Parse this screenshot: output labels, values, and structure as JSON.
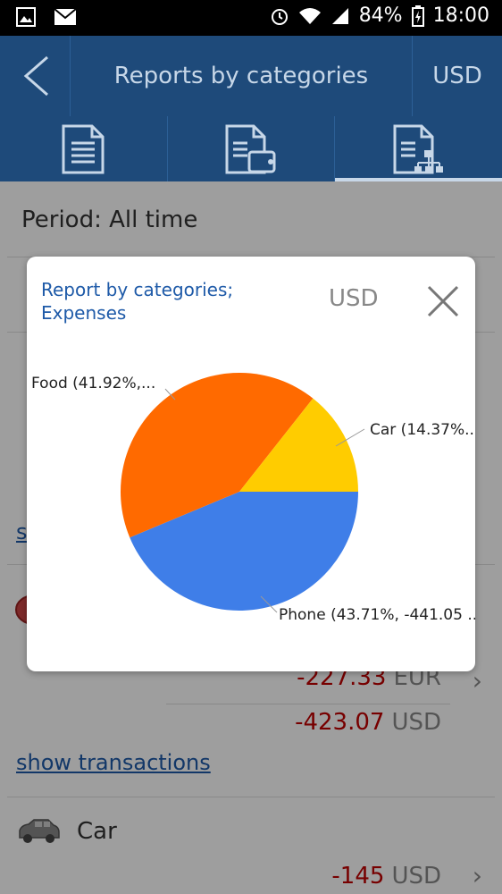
{
  "status_bar": {
    "battery_text": "84%",
    "time": "18:00",
    "icons": [
      "image-icon",
      "mail-icon",
      "alarm-icon",
      "wifi-icon",
      "signal-icon",
      "battery-icon"
    ]
  },
  "app_bar": {
    "title": "Reports by categories",
    "currency": "USD",
    "tabs": [
      {
        "name": "document-report-icon"
      },
      {
        "name": "wallet-report-icon"
      },
      {
        "name": "category-tree-report-icon"
      }
    ]
  },
  "background": {
    "period_label": "Period: All time",
    "link_partial": "s",
    "group": {
      "amount_eur": "-227.33",
      "amount_eur_currency": "EUR",
      "amount_usd": "-423.07",
      "amount_usd_currency": "USD",
      "show_transactions": "show transactions"
    },
    "car": {
      "name": "Car",
      "amount": "-145",
      "currency": "USD"
    }
  },
  "dialog": {
    "title_line1": "Report by categories;",
    "title_line2": "Expenses",
    "currency": "USD",
    "chart_labels": {
      "food": "Food (41.92%,...",
      "car": "Car (14.37%...",
      "phone": "Phone (43.71%, -441.05 ..."
    }
  },
  "chart_data": {
    "type": "pie",
    "slices": [
      {
        "label": "Phone",
        "percent": 43.71,
        "value": -441.05,
        "color": "#3f7ee8"
      },
      {
        "label": "Food",
        "percent": 41.92,
        "color": "#ff6a00"
      },
      {
        "label": "Car",
        "percent": 14.37,
        "color": "#ffcc00"
      }
    ]
  }
}
